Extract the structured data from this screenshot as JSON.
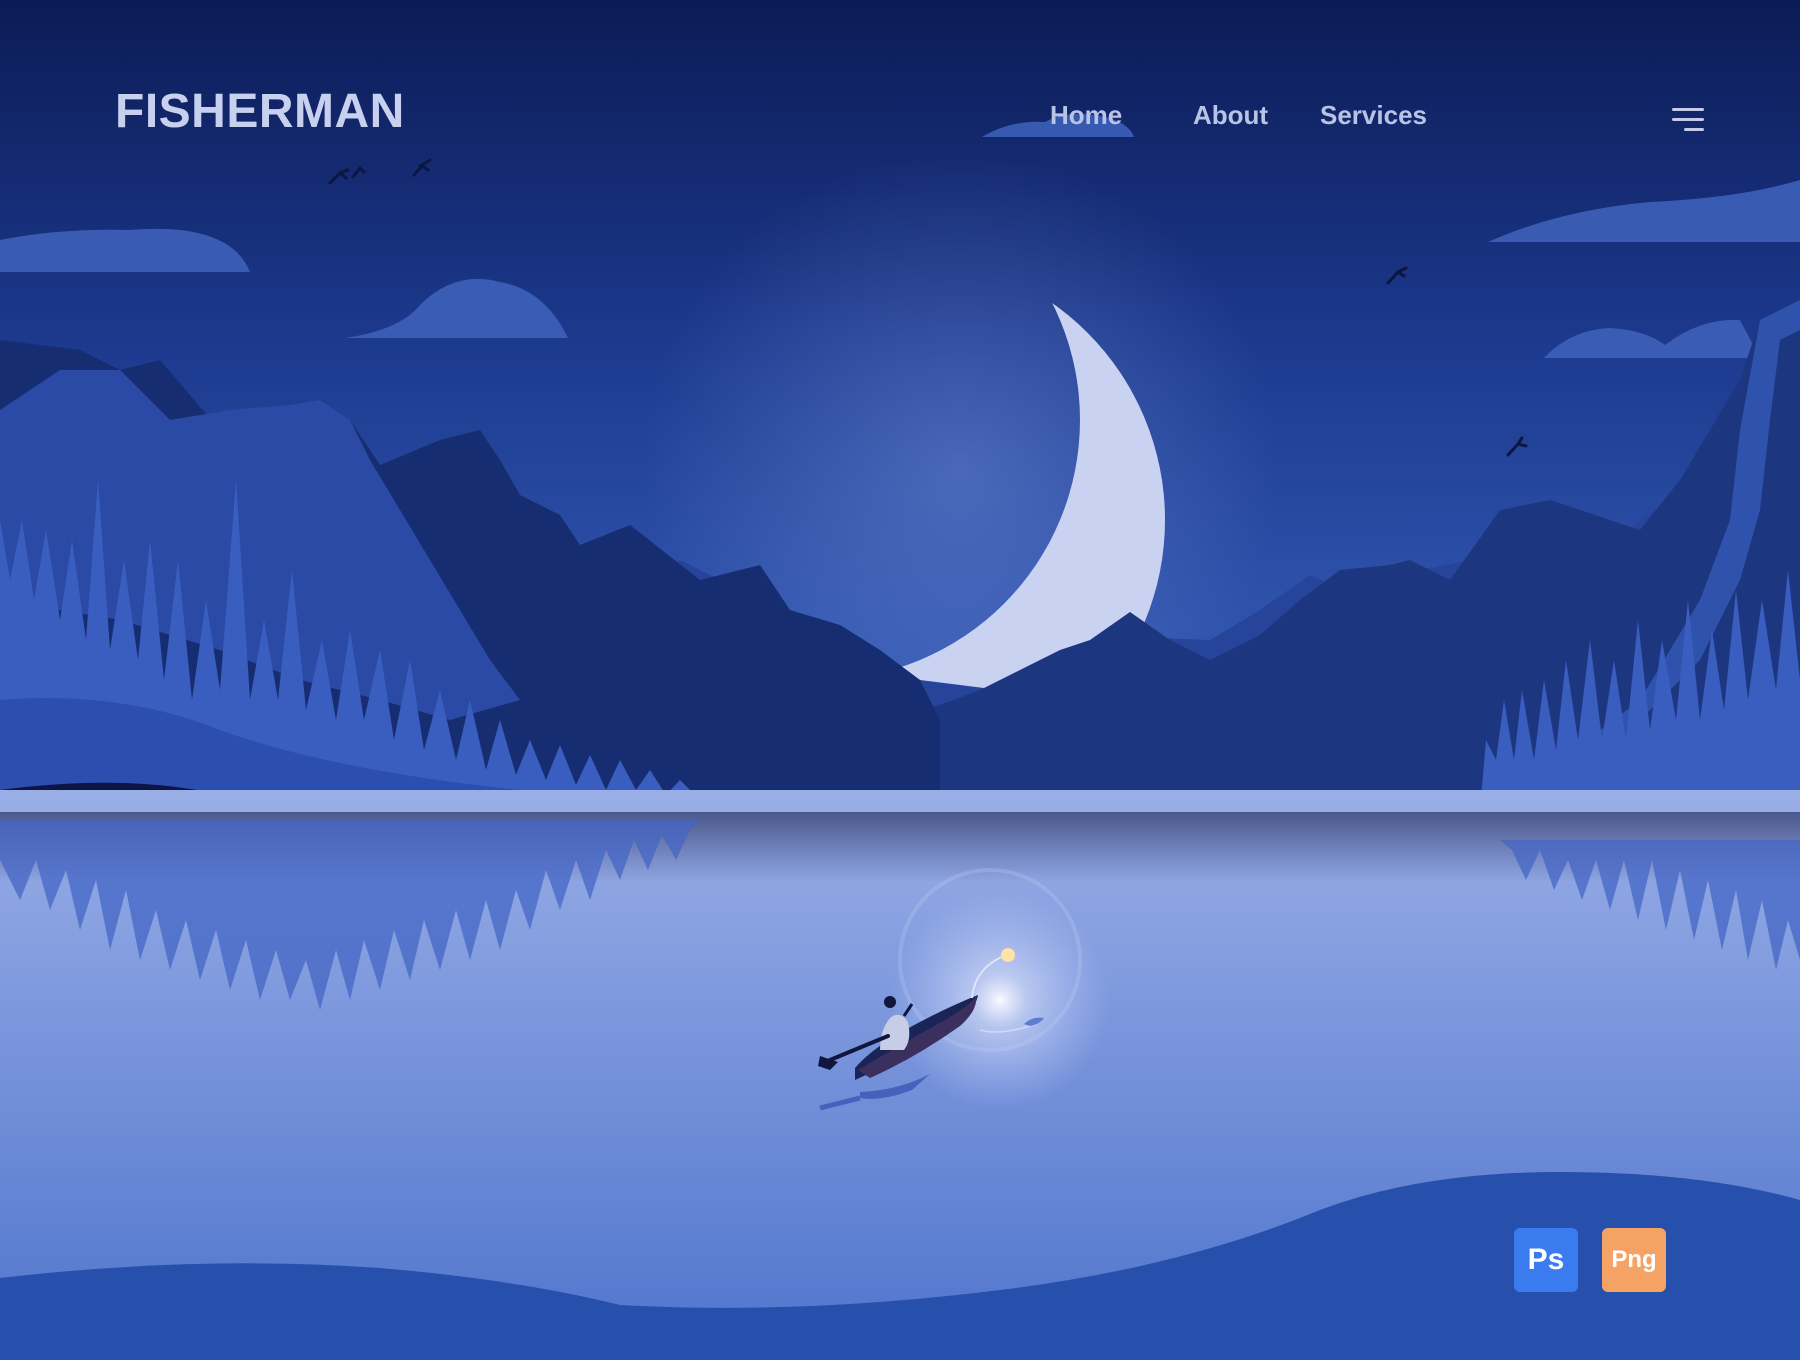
{
  "brand": {
    "logo_text": "FISHERMAN"
  },
  "nav": {
    "items": [
      {
        "label": "Home"
      },
      {
        "label": "About"
      },
      {
        "label": "Services"
      }
    ],
    "menu_icon": "hamburger-menu-icon"
  },
  "badges": {
    "ps": {
      "label": "Ps",
      "color": "#3a7cf0"
    },
    "png": {
      "label": "Png",
      "color": "#f4a365"
    }
  },
  "colors": {
    "sky_top": "#0c1b56",
    "sky_bottom": "#2f56b0",
    "moon": "#c9d3f1",
    "lake": "#7d98dd",
    "text": "#c7d0ee"
  }
}
